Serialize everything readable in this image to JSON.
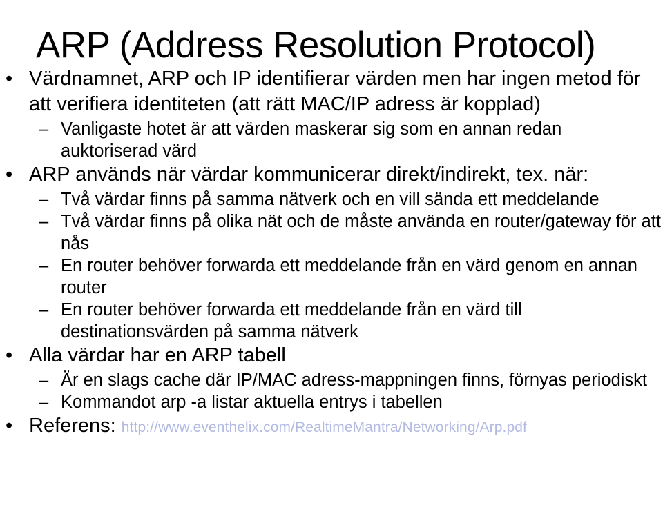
{
  "slide": {
    "title": "ARP (Address Resolution Protocol)",
    "background_color": "#ffffff",
    "text_color": "#000000",
    "link_color": "#b3bae2",
    "bullet_marker_level1": "•",
    "bullet_marker_level2": "–",
    "content": [
      {
        "level": 1,
        "text": "Värdnamnet, ARP och IP identifierar värden men har ingen metod för att verifiera identiteten (att rätt MAC/IP adress är kopplad)"
      },
      {
        "level": 2,
        "text": "Vanligaste hotet är att värden maskerar sig som en annan redan auktoriserad värd"
      },
      {
        "level": 1,
        "text": "ARP används när värdar kommunicerar direkt/indirekt, tex. när:"
      },
      {
        "level": 2,
        "text": "Två värdar finns på samma nätverk och en vill sända ett meddelande"
      },
      {
        "level": 2,
        "text": "Två värdar finns på olika nät och de måste använda en router/gateway för att nås"
      },
      {
        "level": 2,
        "text": "En router behöver forwarda ett meddelande från en värd genom en annan router"
      },
      {
        "level": 2,
        "text": "En router behöver forwarda ett meddelande från en värd till destinationsvärden på samma nätverk"
      },
      {
        "level": 1,
        "text": "Alla värdar har en ARP tabell"
      },
      {
        "level": 2,
        "text": "Är en slags cache där IP/MAC adress-mappningen finns, förnyas periodiskt"
      },
      {
        "level": 2,
        "text": "Kommandot arp -a listar aktuella entrys i tabellen"
      }
    ],
    "reference": {
      "label": "Referens:",
      "url": "http://www.eventhelix.com/RealtimeMantra/Networking/Arp.pdf"
    }
  }
}
